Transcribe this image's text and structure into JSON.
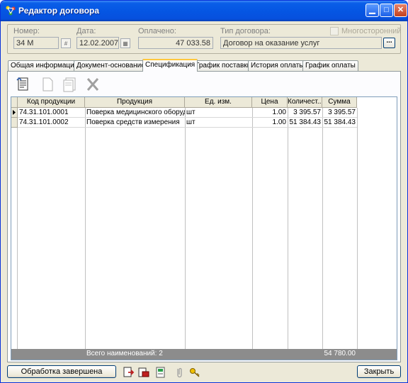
{
  "window": {
    "title": "Редактор договора"
  },
  "header": {
    "number_label": "Номер:",
    "number_value": "34 М",
    "date_label": "Дата:",
    "date_value": "12.02.2007",
    "paid_label": "Оплачено:",
    "paid_value": "47 033.58",
    "type_label": "Тип договора:",
    "type_value": "Договор на оказание услуг",
    "multi_label": "Многосторонний"
  },
  "tabs": [
    {
      "label": "Общая информация"
    },
    {
      "label": "Документ-основание"
    },
    {
      "label": "Спецификация"
    },
    {
      "label": "График поставки"
    },
    {
      "label": "История оплаты"
    },
    {
      "label": "График оплаты"
    }
  ],
  "grid": {
    "columns": [
      "Код продукции",
      "Продукция",
      "Ед. изм.",
      "Цена",
      "Количест...",
      "Сумма"
    ],
    "rows": [
      {
        "code": "74.31.101.0001",
        "product": "Поверка медицинского оборудования",
        "unit": "шт",
        "price": "1.00",
        "qty": "3 395.57",
        "sum": "3 395.57"
      },
      {
        "code": "74.31.101.0002",
        "product": "Поверка средств измерения",
        "unit": "шт",
        "price": "1.00",
        "qty": "51 384.43",
        "sum": "51 384.43"
      }
    ],
    "footer_count": "Всего наименований: 2",
    "footer_total": "54 780.00"
  },
  "bottom": {
    "done_label": "Обработка завершена",
    "close_label": "Закрыть"
  }
}
